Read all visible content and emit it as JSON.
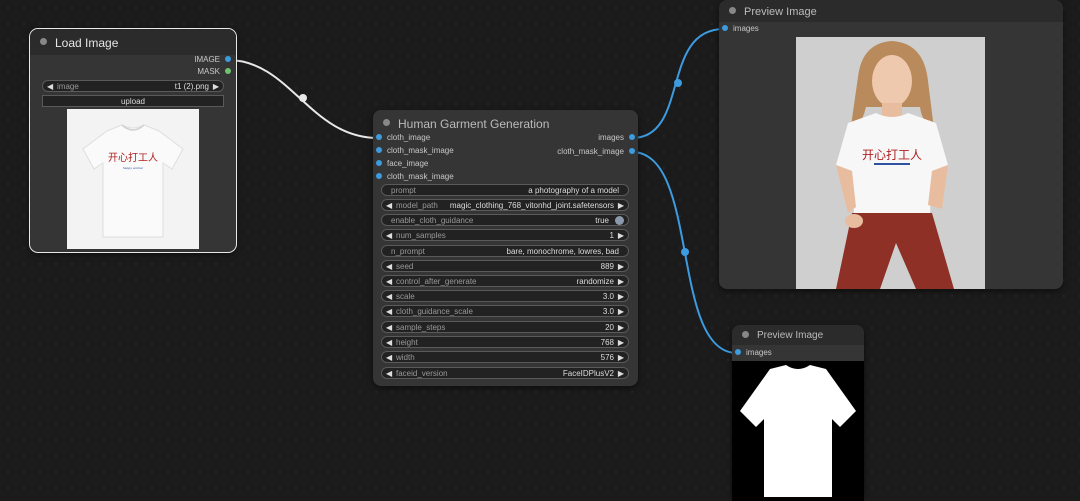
{
  "load_image": {
    "title": "Load Image",
    "outputs": [
      "IMAGE",
      "MASK"
    ],
    "image_widget": {
      "label": "image",
      "value": "t1 (2).png"
    },
    "upload_label": "upload",
    "shirt_text": "开心打工人",
    "shirt_subtext": "happy worker"
  },
  "garment": {
    "title": "Human Garment Generation",
    "inputs": [
      "cloth_image",
      "cloth_mask_image",
      "face_image",
      "cloth_mask_image"
    ],
    "outputs": [
      "images",
      "cloth_mask_image"
    ],
    "widgets": {
      "prompt": {
        "label": "prompt",
        "value": "a photography of a model"
      },
      "model_path": {
        "label": "model_path",
        "value": "magic_clothing_768_vitonhd_joint.safetensors"
      },
      "enable_cloth_guidance": {
        "label": "enable_cloth_guidance",
        "value": "true"
      },
      "num_samples": {
        "label": "num_samples",
        "value": "1"
      },
      "n_prompt": {
        "label": "n_prompt",
        "value": "bare, monochrome, lowres, bad"
      },
      "seed": {
        "label": "seed",
        "value": "889"
      },
      "control_after_generate": {
        "label": "control_after_generate",
        "value": "randomize"
      },
      "scale": {
        "label": "scale",
        "value": "3.0"
      },
      "cloth_guidance_scale": {
        "label": "cloth_guidance_scale",
        "value": "3.0"
      },
      "sample_steps": {
        "label": "sample_steps",
        "value": "20"
      },
      "height": {
        "label": "height",
        "value": "768"
      },
      "width": {
        "label": "width",
        "value": "576"
      },
      "faceid_version": {
        "label": "faceid_version",
        "value": "FaceIDPlusV2"
      }
    }
  },
  "preview1": {
    "title": "Preview Image",
    "input": "images",
    "shirt_text": "开心打工人"
  },
  "preview2": {
    "title": "Preview Image",
    "input": "images"
  },
  "colors": {
    "link_blue": "#3d9be0",
    "link_white": "#e8e8e8",
    "background": "#1b1b1b",
    "node": "#353535"
  }
}
